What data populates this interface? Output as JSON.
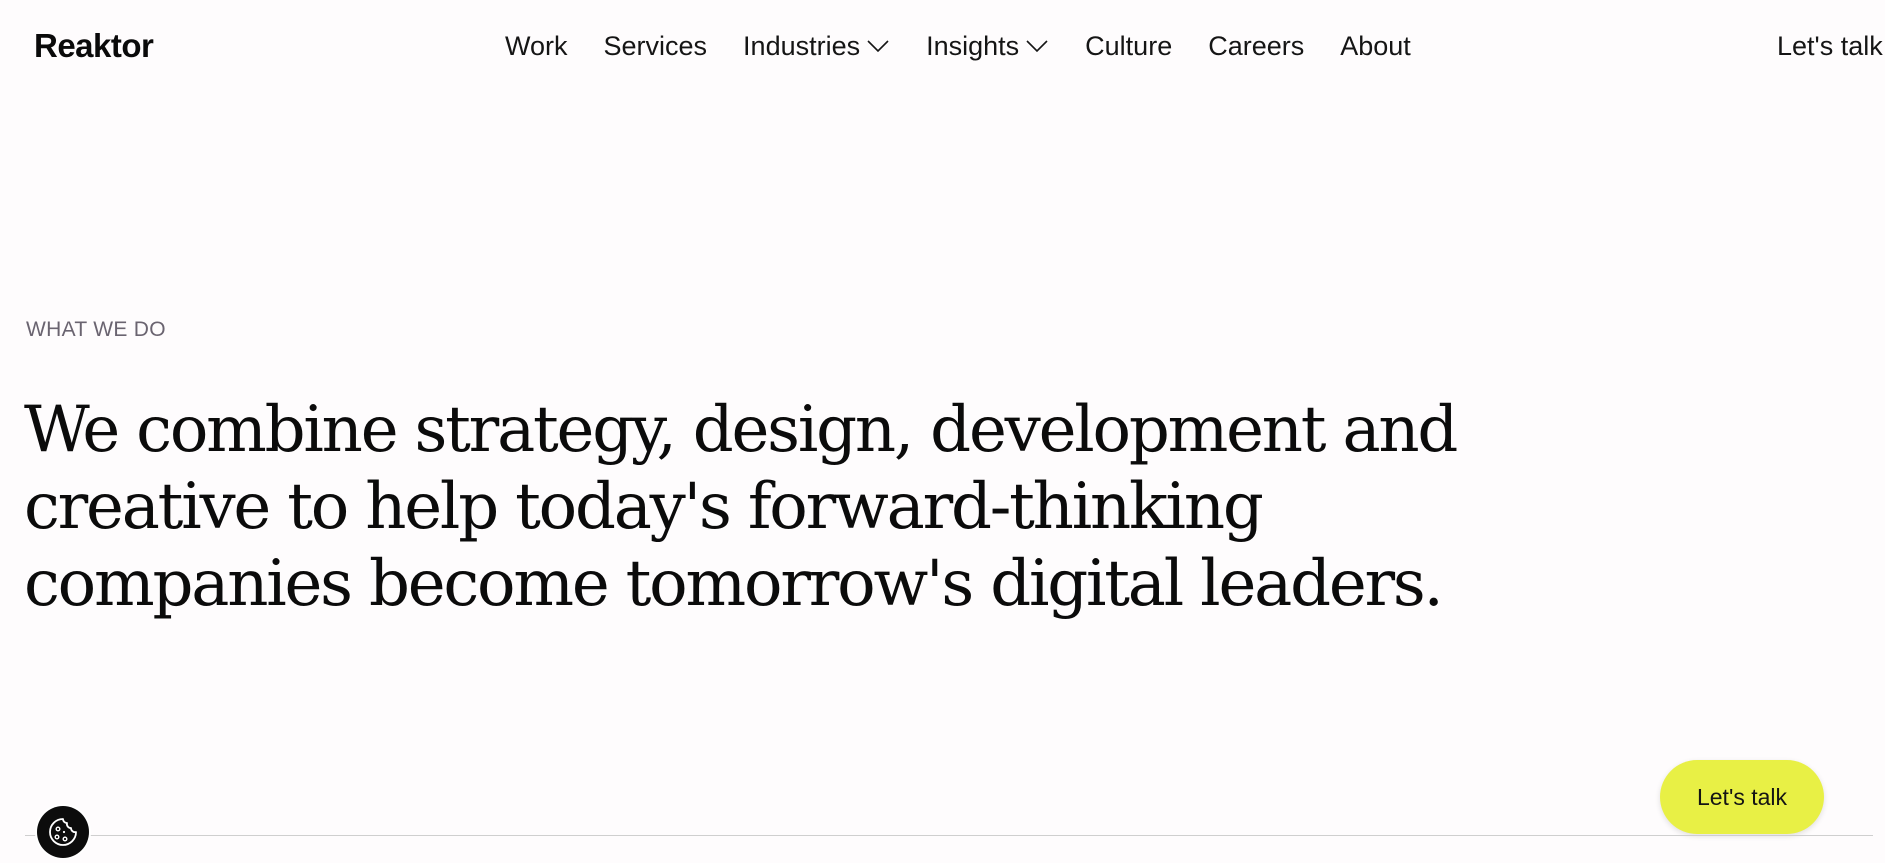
{
  "brand": {
    "logo_text": "Reaktor"
  },
  "nav": {
    "items": [
      {
        "label": "Work"
      },
      {
        "label": "Services"
      },
      {
        "label": "Industries",
        "icon": "chevron-down-icon"
      },
      {
        "label": "Insights",
        "icon": "chevron-down-icon"
      },
      {
        "label": "Culture"
      },
      {
        "label": "Careers"
      },
      {
        "label": "About"
      }
    ],
    "cta_label": "Let's talk"
  },
  "hero": {
    "eyebrow": "WHAT WE DO",
    "headline": "We combine strategy, design, development and creative to help today's forward-thinking companies become tomorrow's digital leaders."
  },
  "floating_cta": {
    "label": "Let's talk"
  },
  "cookie_button": {
    "icon": "cookie-icon"
  },
  "colors": {
    "background": "#fefcfd",
    "text": "#0a0a0a",
    "eyebrow": "#6a6470",
    "accent": "#e8f045",
    "cookie_bg": "#0c0c0c"
  }
}
